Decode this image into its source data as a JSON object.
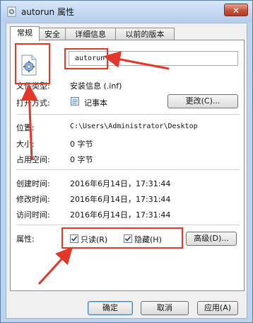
{
  "window": {
    "title": "autorun 属性",
    "close_label": "✕"
  },
  "tabs": [
    {
      "label": "常规",
      "active": true
    },
    {
      "label": "安全",
      "active": false
    },
    {
      "label": "详细信息",
      "active": false
    },
    {
      "label": "以前的版本",
      "active": false
    }
  ],
  "general": {
    "file_name": "autorun",
    "file_type_label": "文件类型:",
    "file_type_value": "安装信息 (.inf)",
    "open_with_label": "打开方式:",
    "open_with_value": "记事本",
    "change_button": "更改(C)...",
    "location_label": "位置:",
    "location_value": "C:\\Users\\Administrator\\Desktop",
    "size_label": "大小:",
    "size_value": "0 字节",
    "size_on_disk_label": "占用空间:",
    "size_on_disk_value": "0 字节",
    "created_label": "创建时间:",
    "created_value": "2016年6月14日，17:31:44",
    "modified_label": "修改时间:",
    "modified_value": "2016年6月14日，17:31:44",
    "accessed_label": "访问时间:",
    "accessed_value": "2016年6月14日，17:31:44",
    "attributes_label": "属性:",
    "readonly_label": "只读(R)",
    "readonly_checked": true,
    "hidden_label": "隐藏(H)",
    "hidden_checked": true,
    "advanced_button": "高级(D)..."
  },
  "footer": {
    "ok_button": "确定",
    "cancel_button": "取消",
    "apply_button": "应用(A)"
  },
  "colors": {
    "annotation_red": "#e0392b",
    "window_frame": "#bcd3ee"
  },
  "icons": {
    "window_icon": "settings-file-icon",
    "file_icon": "inf-gear-file-icon",
    "notepad_icon": "notepad-icon",
    "close_icon": "close-icon",
    "checkmark_icon": "checkmark-icon"
  }
}
